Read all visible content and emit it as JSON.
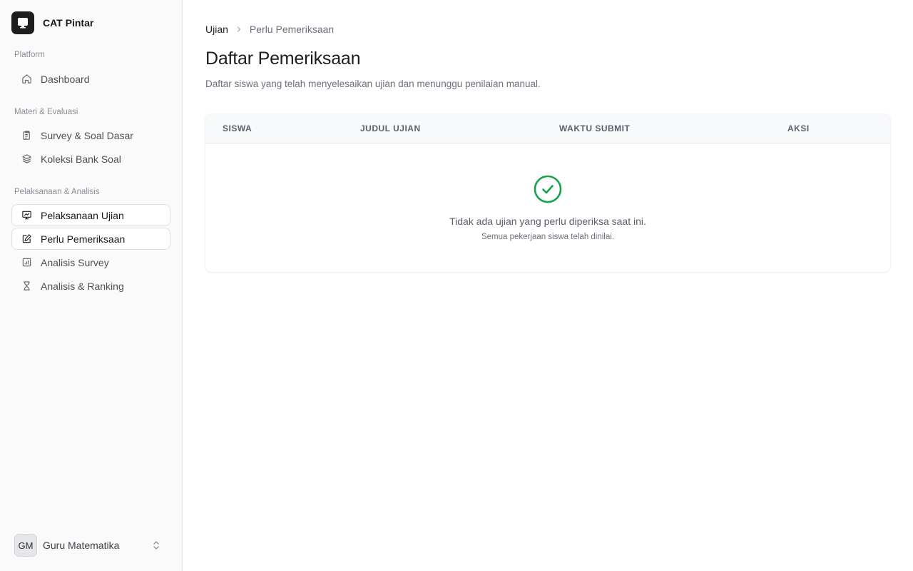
{
  "app": {
    "name": "CAT Pintar"
  },
  "sidebar": {
    "sections": [
      {
        "label": "Platform"
      },
      {
        "label": "Materi & Evaluasi"
      },
      {
        "label": "Pelaksanaan & Analisis"
      }
    ],
    "items": [
      {
        "label": "Dashboard",
        "icon": "home-icon"
      },
      {
        "label": "Survey & Soal Dasar",
        "icon": "clipboard-icon"
      },
      {
        "label": "Koleksi Bank Soal",
        "icon": "layers-icon"
      },
      {
        "label": "Pelaksanaan Ujian",
        "icon": "presentation-chart-icon",
        "active": true
      },
      {
        "label": "Perlu Pemeriksaan",
        "icon": "pencil-square-icon",
        "active": true
      },
      {
        "label": "Analisis Survey",
        "icon": "bar-chart-icon"
      },
      {
        "label": "Analisis & Ranking",
        "icon": "hourglass-icon"
      }
    ],
    "user": {
      "initials": "GM",
      "name": "Guru Matematika"
    }
  },
  "breadcrumb": {
    "parent": "Ujian",
    "current": "Perlu Pemeriksaan"
  },
  "page": {
    "title": "Daftar Pemeriksaan",
    "subtitle": "Daftar siswa yang telah menyelesaikan ujian dan menunggu penilaian manual."
  },
  "table": {
    "columns": [
      "SISWA",
      "JUDUL UJIAN",
      "WAKTU SUBMIT",
      "AKSI"
    ],
    "empty": {
      "title": "Tidak ada ujian yang perlu diperiksa saat ini.",
      "subtitle": "Semua pekerjaan siswa telah dinilai."
    }
  },
  "colors": {
    "accent_success": "#16a34a",
    "sidebar_bg": "#fafafa",
    "text_primary": "#1f2328"
  }
}
